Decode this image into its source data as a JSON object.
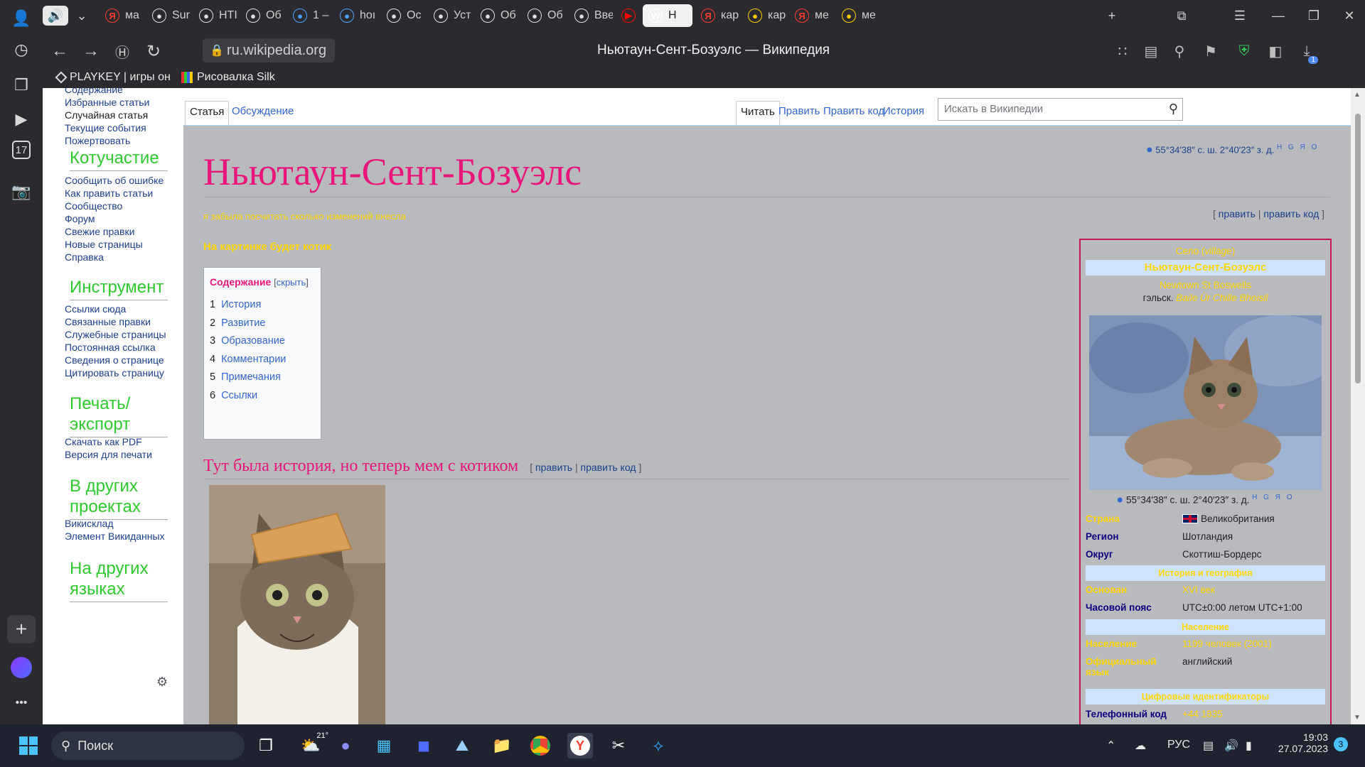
{
  "browser": {
    "tabs": [
      {
        "label": "ма",
        "icon": "yandex-icon",
        "color": "#ff3b30"
      },
      {
        "label": "Sur",
        "icon": "github-icon",
        "color": "#e0e0e0"
      },
      {
        "label": "НТІ",
        "icon": "openai-icon",
        "color": "#e0e0e0"
      },
      {
        "label": "Об",
        "icon": "openai-icon",
        "color": "#e0e0e0"
      },
      {
        "label": "1 –",
        "icon": "feather-icon",
        "color": "#4aa3ff"
      },
      {
        "label": "hoı",
        "icon": "document-icon",
        "color": "#4aa3ff"
      },
      {
        "label": "Ос",
        "icon": "openai-icon",
        "color": "#e0e0e0"
      },
      {
        "label": "Уст",
        "icon": "openai-icon",
        "color": "#e0e0e0"
      },
      {
        "label": "Об",
        "icon": "openai-icon",
        "color": "#e0e0e0"
      },
      {
        "label": "Об",
        "icon": "openai-icon",
        "color": "#e0e0e0"
      },
      {
        "label": "Вве",
        "icon": "openai-icon",
        "color": "#e0e0e0"
      },
      {
        "label": "",
        "icon": "youtube-icon",
        "color": "#ff0000"
      },
      {
        "label": "Н",
        "icon": "wikipedia-icon",
        "color": "#ffffff"
      },
      {
        "label": "кар",
        "icon": "yandex-icon",
        "color": "#ff3b30"
      },
      {
        "label": "кар",
        "icon": "yandex-maps-icon",
        "color": "#ffcc00"
      },
      {
        "label": "ме",
        "icon": "yandex-icon",
        "color": "#ff3b30"
      },
      {
        "label": "ме",
        "icon": "yandex-maps-icon",
        "color": "#ffcc00"
      }
    ],
    "url": "ru.wikipedia.org",
    "window_title": "Ньютаун-Сент-Бозуэлс — Википедия",
    "bookmarks": [
      "PLAYKEY | игры он",
      "Рисовалка Silk"
    ],
    "downloads_badge": "1",
    "calendar_day": "17"
  },
  "wiki": {
    "nav_top": [
      "Содержание",
      "Избранные статьи",
      "Случайная статья",
      "Текущие события",
      "Пожертвовать"
    ],
    "nav_sections": [
      {
        "heading": "Котучастие",
        "links": [
          "Сообщить об ошибке",
          "Как править статьи",
          "Сообщество",
          "Форум",
          "Свежие правки",
          "Новые страницы",
          "Справка"
        ]
      },
      {
        "heading": "Инструмент",
        "links": [
          "Ссылки сюда",
          "Связанные правки",
          "Служебные страницы",
          "Постоянная ссылка",
          "Сведения о странице",
          "Цитировать страницу"
        ]
      },
      {
        "heading": "Печать/ экспорт",
        "links": [
          "Скачать как PDF",
          "Версия для печати"
        ]
      },
      {
        "heading": "В других проектах",
        "links": [
          "Викисклад",
          "Элемент Викиданных"
        ]
      },
      {
        "heading": "На других языках",
        "links": []
      }
    ],
    "tabs_left": [
      "Статья",
      "Обсуждение"
    ],
    "tabs_right": [
      "Читать",
      "Править",
      "Править код",
      "История"
    ],
    "search_placeholder": "Искать в Википедии",
    "title": "Ньютаун-Сент-Бозуэлс",
    "coords": "55°34′38″ с. ш. 2°40′23″ з. д.",
    "coords_links": "H G Я O",
    "edit_note": "я забыла посчитать сколько изменений внесла",
    "edit_links": {
      "open": "[",
      "edit": "править",
      "sep": "|",
      "edit_code": "править код",
      "close": "]"
    },
    "lead": "На картинке будет котик",
    "toc": {
      "title": "Содержание",
      "hide_open": "[",
      "hide": "скрыть",
      "hide_close": "]",
      "items": [
        {
          "num": "1",
          "text": "История"
        },
        {
          "num": "2",
          "text": "Развитие"
        },
        {
          "num": "3",
          "text": "Образование"
        },
        {
          "num": "4",
          "text": "Комментарии"
        },
        {
          "num": "5",
          "text": "Примечания"
        },
        {
          "num": "6",
          "text": "Ссылки"
        }
      ]
    },
    "section_heading": "Тут была история, но теперь мем с котиком",
    "infobox": {
      "type_line": "Село (",
      "type_italic": "village",
      "type_close": ")",
      "name": "Ньютаун-Сент-Бозуэлс",
      "name_en": "Newtown St Boswells",
      "gaelic_label": "гэльск.",
      "gaelic_name": "Baile Ùr Chille Bhoisil",
      "coords": "55°34′38″ с. ш. 2°40′23″ з. д.",
      "coords_links": "H G Я O",
      "rows_a": [
        {
          "label": "Страна",
          "value": "Великобритания",
          "yellow": true
        },
        {
          "label": "Регион",
          "value": "Шотландия",
          "yellow": false
        },
        {
          "label": "Округ",
          "value": "Скоттиш-Бордерс",
          "yellow": false
        }
      ],
      "band1": "История и география",
      "rows_b": [
        {
          "label": "Основан",
          "value": "XVI век"
        },
        {
          "label": "Часовой пояс",
          "value": "UTC±0:00  летом UTC+1:00"
        }
      ],
      "band2": "Население",
      "rows_c": [
        {
          "label": "Население",
          "value": "1199 человек (2001)"
        },
        {
          "label": "Официальный язык",
          "value": "английский"
        }
      ],
      "band3": "Цифровые идентификаторы",
      "rows_d": [
        {
          "label": "Телефонный код",
          "value": "+44 1835"
        }
      ]
    }
  },
  "taskbar": {
    "search": "Поиск",
    "weather": "21°",
    "lang": "РУС",
    "time": "19:03",
    "date": "27.07.2023",
    "notif": "3"
  }
}
